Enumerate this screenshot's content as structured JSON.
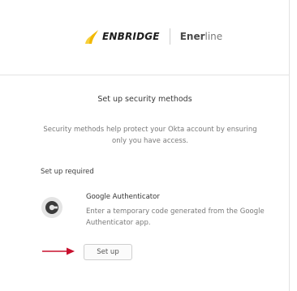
{
  "brand": {
    "name": "ENBRIDGE",
    "app_name_bold": "Ener",
    "app_name_light": "line",
    "accent_color": "#f2b800"
  },
  "main": {
    "title": "Set up security methods",
    "description": "Security methods help protect your Okta account by ensuring only you have access.",
    "required_label": "Set up required"
  },
  "authenticator": {
    "name": "Google Authenticator",
    "description": "Enter a temporary code generated from the Google Authenticator app.",
    "icon": "google-authenticator-icon",
    "setup_label": "Set up"
  },
  "annotation": {
    "arrow_color": "#c8102e"
  }
}
